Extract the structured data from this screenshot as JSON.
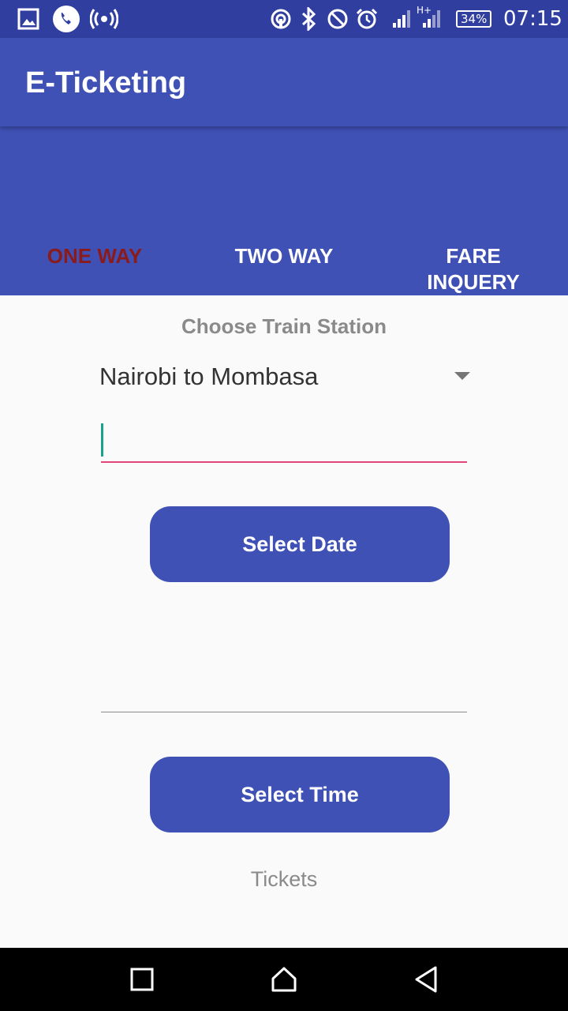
{
  "status_bar": {
    "time": "07:15",
    "battery": "34%",
    "network_type": "H+",
    "icons": [
      "image-icon",
      "phone-icon",
      "hotspot-icon",
      "nfc-icon",
      "bluetooth-icon",
      "do-not-disturb-icon",
      "alarm-icon",
      "signal-icon",
      "signal-icon"
    ]
  },
  "app_bar": {
    "title": "E-Ticketing"
  },
  "tabs": [
    {
      "label": "ONE WAY",
      "active": true
    },
    {
      "label": "TWO WAY",
      "active": false
    },
    {
      "label": "FARE\nINQUERY",
      "active": false
    }
  ],
  "form": {
    "heading": "Choose Train Station",
    "station_select": {
      "value": "Nairobi to Mombasa"
    },
    "text_input": {
      "value": ""
    },
    "select_date_button": "Select Date",
    "select_time_button": "Select Time",
    "tickets_label": "Tickets"
  },
  "nav_bar": {
    "icons": [
      "recents-icon",
      "home-icon",
      "back-icon"
    ]
  },
  "colors": {
    "primary": "#3f51b5",
    "primary_dark": "#303f9f",
    "active_tab": "#8b1a1a",
    "accent_underline": "#e0457b",
    "caret": "#17a589"
  }
}
